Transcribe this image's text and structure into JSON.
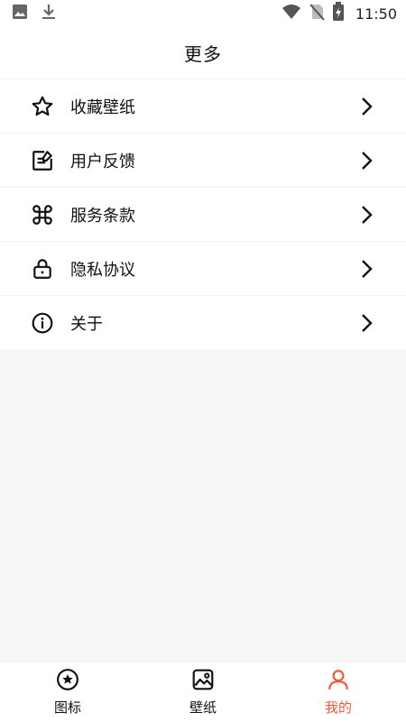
{
  "status_bar": {
    "time": "11:50",
    "left_icons": [
      "image-icon",
      "download-icon"
    ],
    "right_icons": [
      "wifi-icon",
      "no-sim-icon",
      "battery-charging-icon"
    ]
  },
  "header": {
    "title": "更多"
  },
  "menu": {
    "items": [
      {
        "label": "收藏壁纸",
        "icon": "star-icon"
      },
      {
        "label": "用户反馈",
        "icon": "feedback-icon"
      },
      {
        "label": "服务条款",
        "icon": "command-icon"
      },
      {
        "label": "隐私协议",
        "icon": "lock-icon"
      },
      {
        "label": "关于",
        "icon": "info-icon"
      }
    ]
  },
  "tabbar": {
    "tabs": [
      {
        "label": "图标",
        "icon": "star-circle-icon",
        "active": false
      },
      {
        "label": "壁纸",
        "icon": "wallpaper-icon",
        "active": false
      },
      {
        "label": "我的",
        "icon": "user-icon",
        "active": true
      }
    ],
    "active_color": "#f05a3a"
  }
}
